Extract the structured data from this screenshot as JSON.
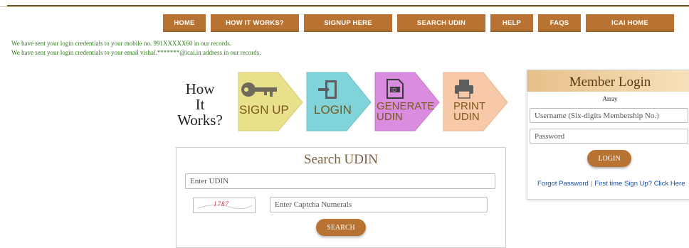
{
  "nav": {
    "items": [
      "HOME",
      "HOW IT WORKS?",
      "SIGNUP HERE",
      "SEARCH UDIN",
      "HELP",
      "FAQS",
      "ICAI HOME"
    ]
  },
  "messages": {
    "mobile": "We have sent your login credentials to your mobile no. 991XXXXX60 in our records.",
    "email": "We have sent your login credentials to your email vishal.*******@icai.in address in our records."
  },
  "how_it_works": {
    "title_lines": [
      "How",
      "It",
      "Works?"
    ],
    "steps": [
      {
        "label_lines": [
          "SIGN UP"
        ],
        "icon": "key-icon",
        "color": "#e8e08a"
      },
      {
        "label_lines": [
          "LOGIN"
        ],
        "icon": "door-exit-icon",
        "color": "#7fd3d9"
      },
      {
        "label_lines": [
          "GENERATE",
          "UDIN"
        ],
        "icon": "id-document-icon",
        "color": "#d98ce0"
      },
      {
        "label_lines": [
          "PRINT",
          "UDIN"
        ],
        "icon": "printer-icon",
        "color": "#f8c9a8"
      }
    ]
  },
  "member_login": {
    "title": "Member Login",
    "subtitle": "Array",
    "username_placeholder": "Username (Six-digits Membership No.)",
    "password_placeholder": "Password",
    "login_label": "LOGIN",
    "forgot_label": "Forgot Password",
    "separator": "|",
    "signup_label": "First time Sign Up? Click Here"
  },
  "search_udin": {
    "title": "Search UDIN",
    "udin_placeholder": "Enter UDIN",
    "captcha_text": "1787",
    "captcha_placeholder": "Enter Captcha Numerals",
    "search_label": "SEARCH"
  },
  "colors": {
    "button": "#b87333",
    "message": "#2f7a1a",
    "link": "#1a4fa0"
  }
}
